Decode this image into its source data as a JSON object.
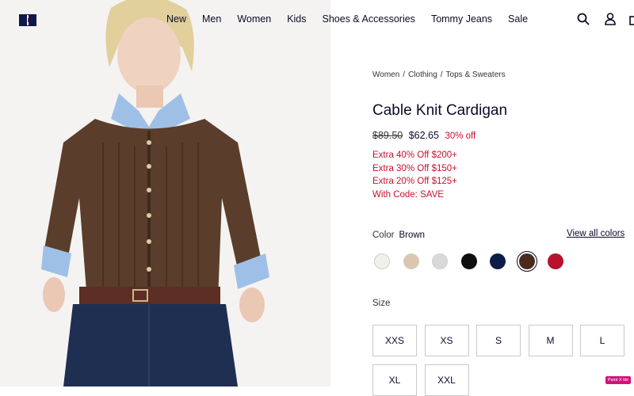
{
  "header": {
    "nav": [
      "New",
      "Men",
      "Women",
      "Kids",
      "Shoes & Accessories",
      "Tommy Jeans",
      "Sale"
    ],
    "icons": [
      "flag-logo",
      "search-icon",
      "user-icon",
      "bag-icon"
    ]
  },
  "product": {
    "breadcrumb": [
      "Women",
      "Clothing",
      "Tops & Sweaters"
    ],
    "title": "Cable Knit Cardigan",
    "price_original": "$89.50",
    "price_sale": "$62.65",
    "discount": "30% off",
    "promos": [
      "Extra 40% Off $200+",
      "Extra 30% Off $150+",
      "Extra 20% Off $125+",
      "With Code: SAVE"
    ],
    "color_label": "Color",
    "color_value": "Brown",
    "view_all_colors": "View all colors",
    "swatches": [
      {
        "name": "ivory",
        "color": "#f2f0ea"
      },
      {
        "name": "beige",
        "color": "#dcc6ad"
      },
      {
        "name": "grey-stripe",
        "color": "#d9d9d9"
      },
      {
        "name": "black",
        "color": "#0e0e0e"
      },
      {
        "name": "navy",
        "color": "#0c1d4a"
      },
      {
        "name": "brown",
        "color": "#4a2c1d",
        "selected": true
      },
      {
        "name": "red",
        "color": "#b8122e"
      }
    ],
    "size_label": "Size",
    "sizes": [
      "XXS",
      "XS",
      "S",
      "M",
      "L",
      "XL",
      "XXL"
    ]
  },
  "badge": "Paint X tile"
}
